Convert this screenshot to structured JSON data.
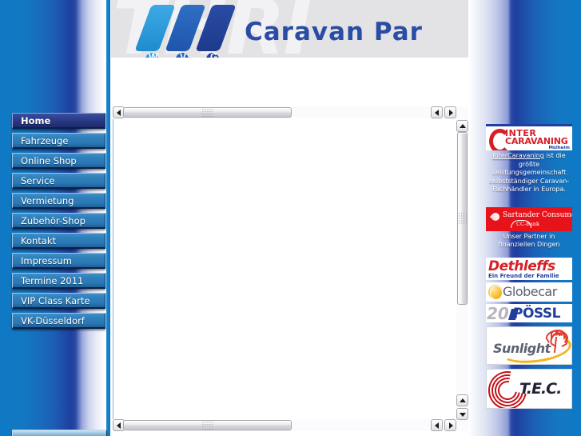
{
  "site": {
    "brand_logo_letters": [
      "W",
      "V",
      "G"
    ],
    "banner_ghost_text": "THRI",
    "banner_title": "Caravan Par",
    "accent_blue": "#1f3f9e",
    "light_blue": "#0f79c6",
    "button_blue": "#2f7fbb",
    "active_button_blue": "#2e3f8c",
    "red": "#d61f26"
  },
  "nav": {
    "items": [
      {
        "label": "Home",
        "active": true
      },
      {
        "label": "Fahrzeuge",
        "active": false
      },
      {
        "label": "Online Shop",
        "active": false
      },
      {
        "label": "Service",
        "active": false
      },
      {
        "label": "Vermietung",
        "active": false
      },
      {
        "label": "Zubehör-Shop",
        "active": false
      },
      {
        "label": "Kontakt",
        "active": false
      },
      {
        "label": "Impressum",
        "active": false
      },
      {
        "label": "Termine 2011",
        "active": false
      },
      {
        "label": "VIP Class Karte",
        "active": false
      },
      {
        "label": "VK-Düsseldorf",
        "active": false
      }
    ]
  },
  "content_frame": {
    "scrollbars": {
      "top_horizontal": {
        "icon_left": "arrow-left-icon",
        "icon_right": "arrow-right-icon"
      },
      "bottom_horizontal": {
        "icon_left": "arrow-left-icon",
        "icon_right": "arrow-right-icon"
      },
      "right_vertical": {
        "icon_up": "arrow-up-icon",
        "icon_down": "arrow-down-icon"
      }
    }
  },
  "ads": {
    "intercaravaning": {
      "line1": "INTER",
      "line2": "CARAVANING",
      "city": "Mülheim",
      "caption_link": "InterCaravaning",
      "caption_rest": " ist die größte Leistungsgemeinschaft selbstständiger Caravan-Fachhändler in Europa."
    },
    "santander": {
      "name": "Sartander Consumer",
      "sub": "CC-Bank",
      "caption": "Unser Partner in finanziellen Dingen"
    },
    "dethleffs": {
      "name": "Dethleffs",
      "slogan": "Ein Freund der Familie"
    },
    "globecar": {
      "name": "Globecar"
    },
    "possl": {
      "years": "20",
      "name": "PÖSSL"
    },
    "sunlight": {
      "name": "Sunlight"
    },
    "tec": {
      "name": "T.E.C."
    }
  }
}
